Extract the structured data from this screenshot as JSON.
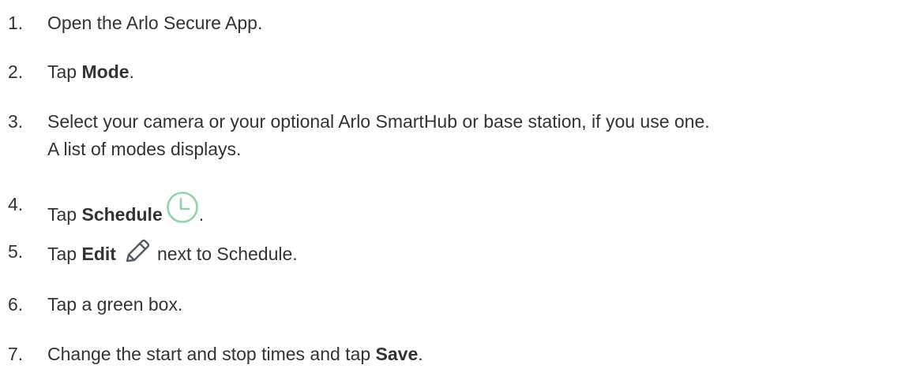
{
  "steps": [
    {
      "number": "1.",
      "text": "Open the Arlo Secure App."
    },
    {
      "number": "2.",
      "prefix": "Tap ",
      "bold": "Mode",
      "suffix": "."
    },
    {
      "number": "3.",
      "line1": "Select your camera or your optional Arlo SmartHub or base station, if you use one.",
      "line2": "A list of modes displays."
    },
    {
      "number": "4.",
      "prefix": "Tap ",
      "bold": "Schedule",
      "icon": "clock-icon",
      "suffix": "."
    },
    {
      "number": "5.",
      "prefix": "Tap ",
      "bold": "Edit",
      "icon": "pencil-icon",
      "suffix": "next to Schedule."
    },
    {
      "number": "6.",
      "text": "Tap a green box."
    },
    {
      "number": "7.",
      "prefix": "Change the start and stop times and tap ",
      "bold": "Save",
      "suffix": "."
    }
  ],
  "colors": {
    "text": "#333333",
    "clock_icon": "#8fd3a8",
    "pencil_icon": "#555b66"
  }
}
